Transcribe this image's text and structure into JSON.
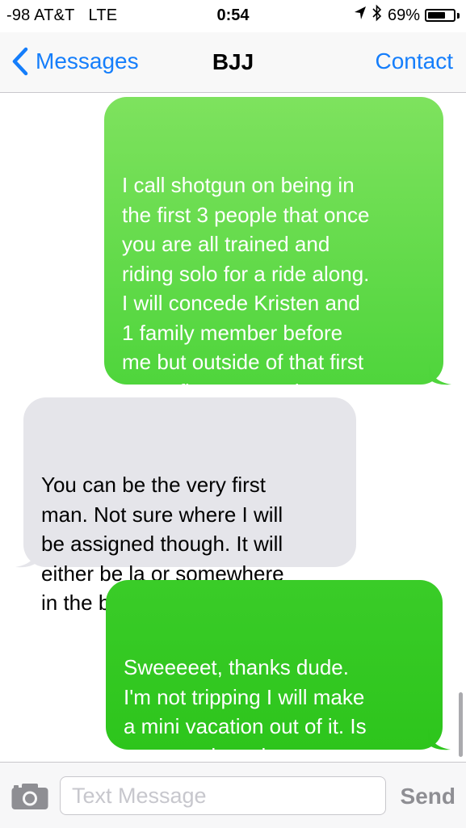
{
  "status_bar": {
    "carrier": "-98 AT&T",
    "network": "LTE",
    "time": "0:54",
    "battery_text": "69%",
    "battery_level": 0.69,
    "location_icon": "location-arrow-icon",
    "bluetooth_icon": "bluetooth-icon"
  },
  "nav": {
    "back_label": "Messages",
    "title": "BJJ",
    "contact_label": "Contact"
  },
  "messages": [
    {
      "direction": "sent",
      "text": "I call shotgun on being in\nthe first 3 people that once\nyou are all trained and\nriding solo for a ride along.\nI will concede Kristen and\n1 family member before\nme but outside of that first\ncome first serve rules\napply"
    },
    {
      "direction": "received",
      "text": "You can be the very first\nman. Not sure where I will\nbe assigned though. It will\neither be la or somewhere\nin the bay."
    },
    {
      "direction": "sent",
      "text": "Sweeeeet, thanks dude.\nI'm not tripping I will make\na mini vacation out of it. Is\nyour academy in west\nsac?"
    }
  ],
  "input_bar": {
    "placeholder": "Text Message",
    "value": "",
    "send_label": "Send",
    "camera_icon": "camera-icon"
  },
  "colors": {
    "accent": "#157efb",
    "sent_bubble_top": "#7ee25e",
    "sent_bubble_bottom": "#2dc51c",
    "received_bubble": "#e5e5ea"
  }
}
